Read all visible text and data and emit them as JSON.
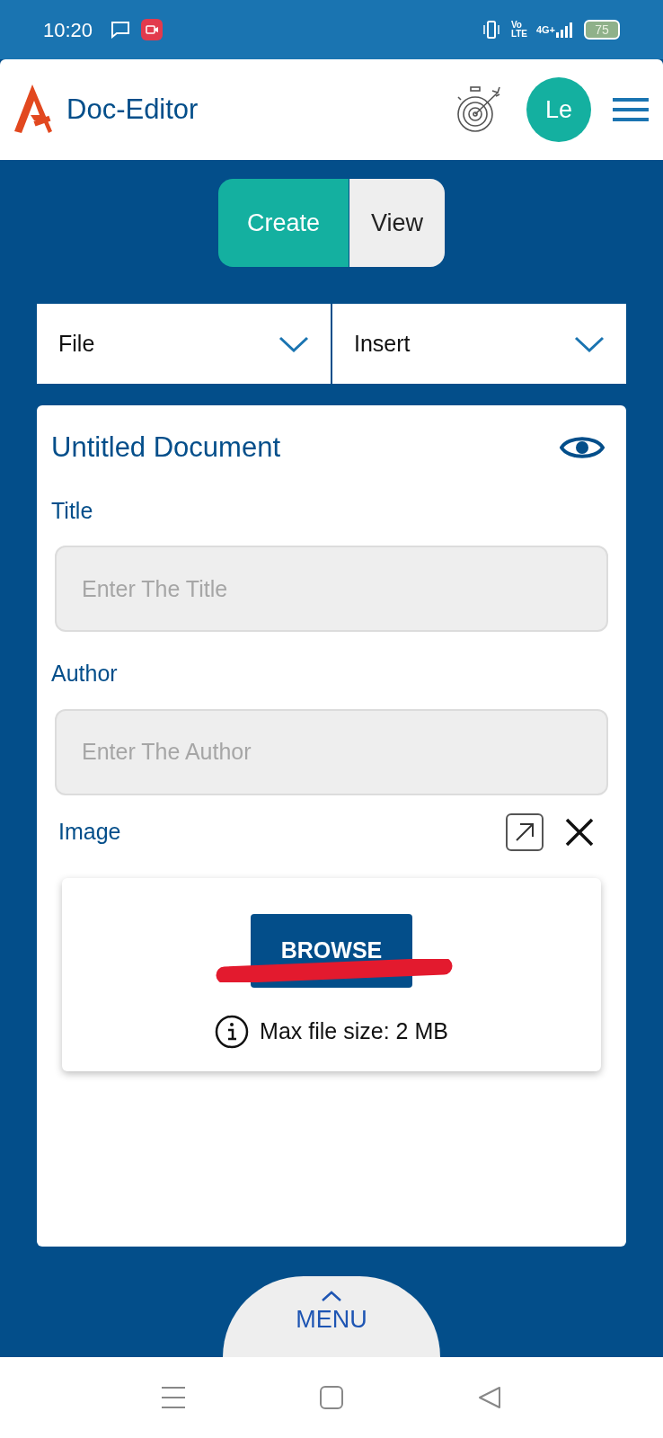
{
  "status_bar": {
    "time": "10:20",
    "volte": "Vo LTE",
    "network": "4G+",
    "battery": "75"
  },
  "header": {
    "app_name": "Doc-Editor",
    "avatar": "Le"
  },
  "mode_tabs": [
    {
      "label": "Create",
      "selected": true
    },
    {
      "label": "View",
      "selected": false
    }
  ],
  "menus": [
    {
      "label": "File"
    },
    {
      "label": "Insert"
    }
  ],
  "document": {
    "title": "Untitled Document",
    "fields": [
      {
        "label": "Title",
        "placeholder": "Enter The Title"
      },
      {
        "label": "Author",
        "placeholder": "Enter The Author"
      }
    ],
    "image": {
      "label": "Image",
      "button": "BROWSE",
      "note": "Max file size: 2 MB"
    }
  },
  "menu_button": {
    "label": "MENU"
  }
}
